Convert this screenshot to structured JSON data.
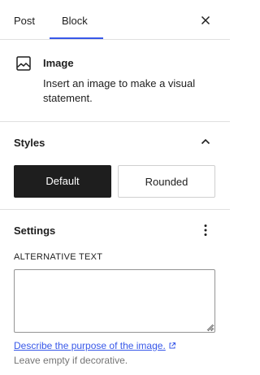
{
  "tabs": {
    "post_label": "Post",
    "block_label": "Block",
    "active": "Block"
  },
  "block": {
    "icon": "image-icon",
    "title": "Image",
    "description": "Insert an image to make a visual statement."
  },
  "styles": {
    "title": "Styles",
    "expanded": true,
    "options": [
      "Default",
      "Rounded"
    ],
    "selected": "Default"
  },
  "settings": {
    "title": "Settings",
    "alt_text_label": "ALTERNATIVE TEXT",
    "alt_text_value": "",
    "help_link": "Describe the purpose of the image.",
    "help_text": "Leave empty if decorative."
  },
  "colors": {
    "accent": "#3858e9",
    "selected_style_bg": "#1e1e1e",
    "text": "#1e1e1e",
    "muted_text": "#757575",
    "divider": "#e0e0e0"
  }
}
